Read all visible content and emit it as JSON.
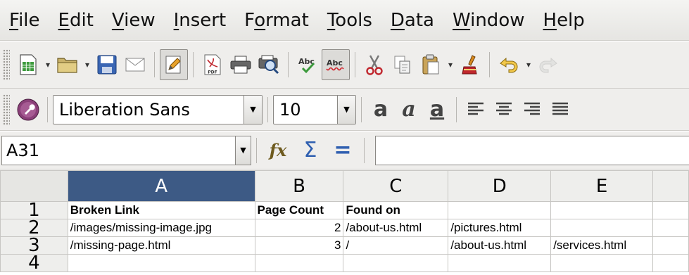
{
  "menu": [
    "File",
    "Edit",
    "View",
    "Insert",
    "Format",
    "Tools",
    "Data",
    "Window",
    "Help"
  ],
  "menu_mnemonics": [
    "F",
    "E",
    "V",
    "I",
    "o",
    "T",
    "D",
    "W",
    "H"
  ],
  "format_toolbar": {
    "font_name": "Liberation Sans",
    "font_size": "10",
    "bold_glyph": "a",
    "italic_glyph": "a",
    "underline_glyph": "a"
  },
  "formula_bar": {
    "cell_reference": "A31",
    "formula_value": ""
  },
  "sheet": {
    "columns": [
      "A",
      "B",
      "C",
      "D",
      "E"
    ],
    "selected_column": "A",
    "rows": [
      {
        "num": "1",
        "cells": [
          "Broken Link",
          "Page Count",
          "Found on",
          "",
          ""
        ]
      },
      {
        "num": "2",
        "cells": [
          "/images/missing-image.jpg",
          "2",
          "/about-us.html",
          "/pictures.html",
          ""
        ]
      },
      {
        "num": "3",
        "cells": [
          "/missing-page.html",
          "3",
          "/",
          "/about-us.html",
          "/services.html"
        ]
      },
      {
        "num": "4",
        "cells": [
          "",
          "",
          "",
          "",
          ""
        ]
      }
    ]
  },
  "colors": {
    "selected_header": "#3d5a85",
    "toolbar_bg": "#efeeec"
  }
}
